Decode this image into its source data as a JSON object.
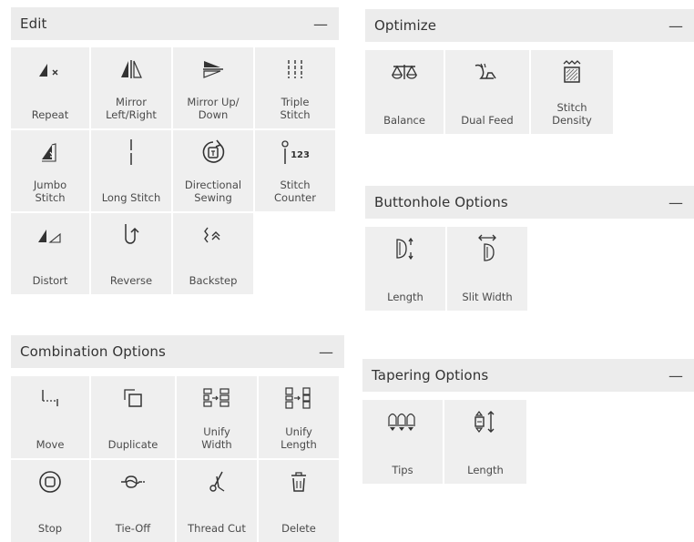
{
  "edit": {
    "title": "Edit",
    "collapse": "—",
    "items": [
      {
        "label": "Repeat",
        "icon": "repeat-icon"
      },
      {
        "label": "Mirror\nLeft/Right",
        "icon": "mirror-left-right-icon"
      },
      {
        "label": "Mirror Up/\nDown",
        "icon": "mirror-up-down-icon"
      },
      {
        "label": "Triple\nStitch",
        "icon": "triple-stitch-icon"
      },
      {
        "label": "Jumbo\nStitch",
        "icon": "jumbo-stitch-icon"
      },
      {
        "label": "Long Stitch",
        "icon": "long-stitch-icon"
      },
      {
        "label": "Directional\nSewing",
        "icon": "directional-sewing-icon"
      },
      {
        "label": "Stitch\nCounter",
        "icon": "stitch-counter-icon",
        "icon_text": "123"
      },
      {
        "label": "Distort",
        "icon": "distort-icon"
      },
      {
        "label": "Reverse",
        "icon": "reverse-icon"
      },
      {
        "label": "Backstep",
        "icon": "backstep-icon"
      }
    ]
  },
  "optimize": {
    "title": "Optimize",
    "collapse": "—",
    "items": [
      {
        "label": "Balance",
        "icon": "balance-icon"
      },
      {
        "label": "Dual Feed",
        "icon": "dual-feed-icon"
      },
      {
        "label": "Stitch\nDensity",
        "icon": "stitch-density-icon"
      }
    ]
  },
  "buttonhole": {
    "title": "Buttonhole Options",
    "collapse": "—",
    "items": [
      {
        "label": "Length",
        "icon": "buttonhole-length-icon"
      },
      {
        "label": "Slit Width",
        "icon": "slit-width-icon"
      }
    ]
  },
  "combination": {
    "title": "Combination Options",
    "collapse": "—",
    "items": [
      {
        "label": "Move",
        "icon": "move-icon"
      },
      {
        "label": "Duplicate",
        "icon": "duplicate-icon"
      },
      {
        "label": "Unify\nWidth",
        "icon": "unify-width-icon"
      },
      {
        "label": "Unify\nLength",
        "icon": "unify-length-icon"
      },
      {
        "label": "Stop",
        "icon": "stop-icon"
      },
      {
        "label": "Tie-Off",
        "icon": "tie-off-icon"
      },
      {
        "label": "Thread Cut",
        "icon": "thread-cut-icon"
      },
      {
        "label": "Delete",
        "icon": "delete-icon"
      }
    ]
  },
  "tapering": {
    "title": "Tapering Options",
    "collapse": "—",
    "items": [
      {
        "label": "Tips",
        "icon": "tips-icon"
      },
      {
        "label": "Length",
        "icon": "tapering-length-icon"
      }
    ]
  }
}
